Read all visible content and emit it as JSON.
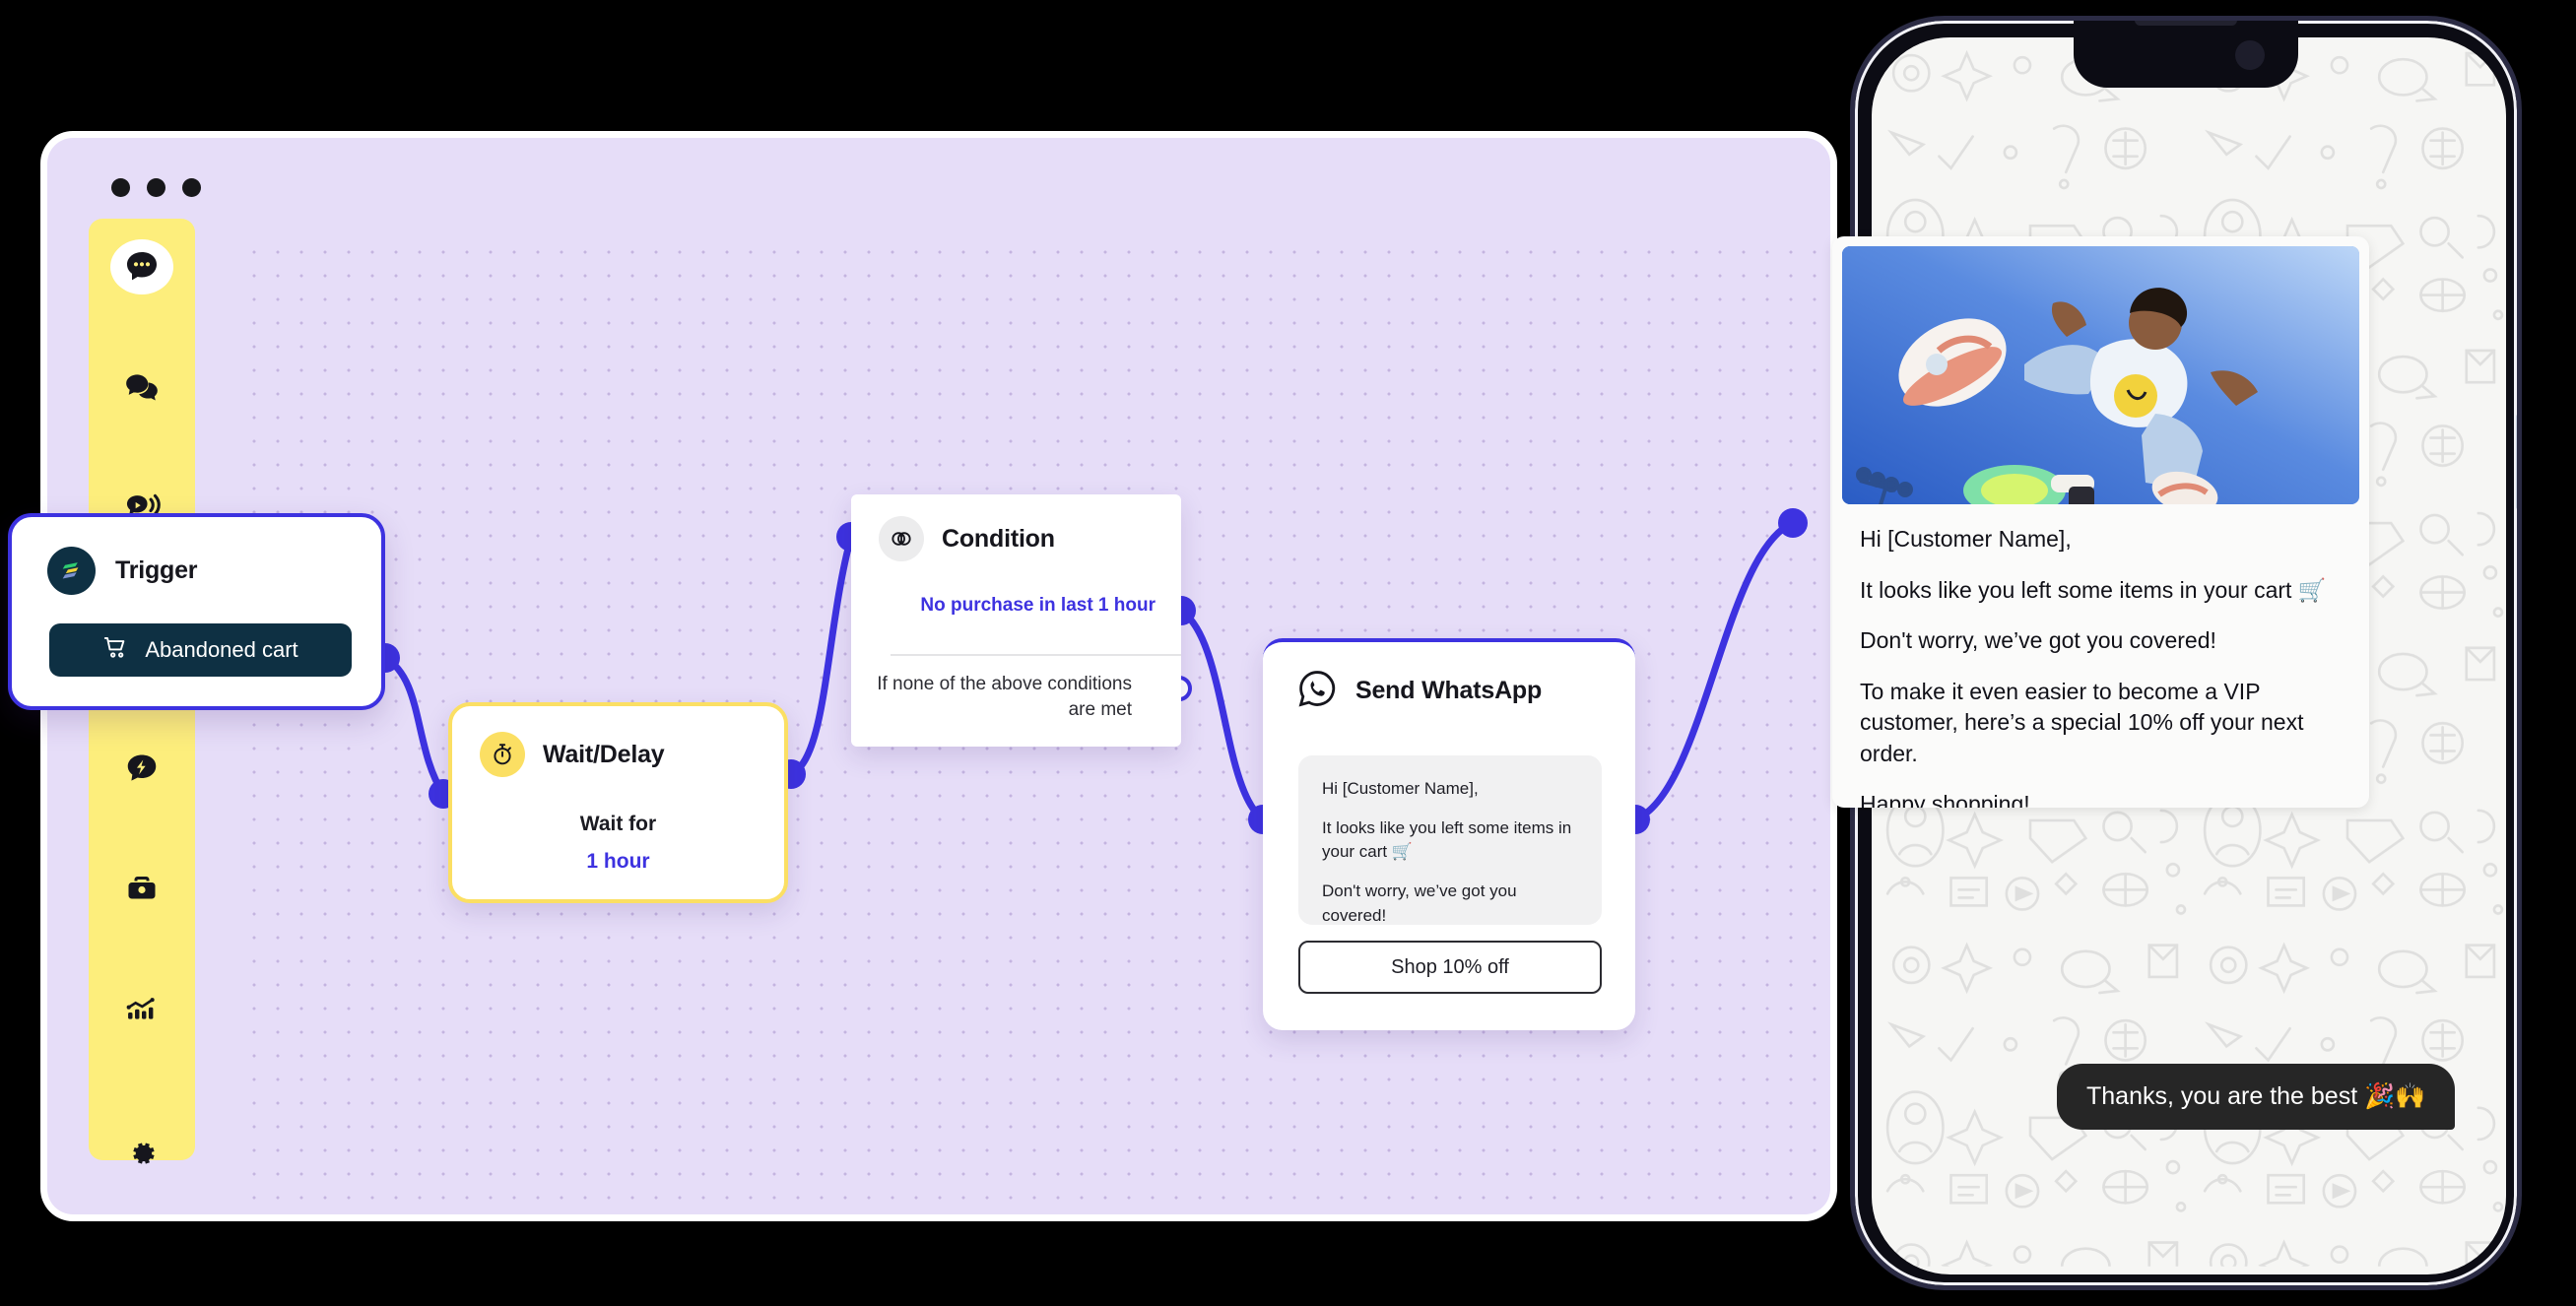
{
  "browser": {
    "window_dots": [
      "dot-1",
      "dot-2",
      "dot-3"
    ],
    "accent_purple": "#3d32e0",
    "canvas_bg": "#e6ddf8",
    "sidebar_bg": "#fdee7c"
  },
  "sidebar": {
    "items": [
      {
        "name": "chat-bubble-dots-icon",
        "label": "Chats",
        "active": true
      },
      {
        "name": "chat-bubbles-icon",
        "label": "Conversations",
        "active": false
      },
      {
        "name": "chat-broadcast-icon",
        "label": "Broadcast",
        "active": false
      },
      {
        "name": "chat-bolt-icon",
        "label": "Automation",
        "active": false
      },
      {
        "name": "briefcase-icon",
        "label": "Commerce",
        "active": false
      },
      {
        "name": "analytics-chart-icon",
        "label": "Analytics",
        "active": false
      },
      {
        "name": "gear-icon",
        "label": "Settings",
        "active": false
      }
    ]
  },
  "flow": {
    "trigger": {
      "title": "Trigger",
      "logo": "brand-logo-icon",
      "button_label": "Abandoned cart",
      "button_icon": "shopping-cart-icon",
      "border_color": "#3d32e0"
    },
    "wait": {
      "title": "Wait/Delay",
      "icon": "stopwatch-icon",
      "label": "Wait for",
      "value": "1 hour",
      "border_color": "#fbdf63"
    },
    "condition": {
      "title": "Condition",
      "icon": "venn-diagram-icon",
      "branch_true": "No purchase in last 1 hour",
      "branch_fallback": "If none of the above conditions are met"
    },
    "whatsapp": {
      "title": "Send WhatsApp",
      "icon": "whatsapp-icon",
      "message_lines": [
        "Hi [Customer Name],",
        "It looks like you left some items in your cart 🛒",
        "Don't worry, we’ve got you covered!"
      ],
      "cta_label": "Shop 10% off",
      "border_color": "#3d32e0"
    }
  },
  "phone": {
    "message": {
      "image": "skateboarder-photo",
      "lines": [
        "Hi [Customer Name],",
        "It looks like you left some items in your cart 🛒",
        "Don't worry, we’ve got you covered!",
        "To make it even easier to become a VIP customer, here’s a special 10% off your next order.",
        "Happy shopping!"
      ]
    },
    "reply": "Thanks, you are the best 🎉🙌"
  }
}
